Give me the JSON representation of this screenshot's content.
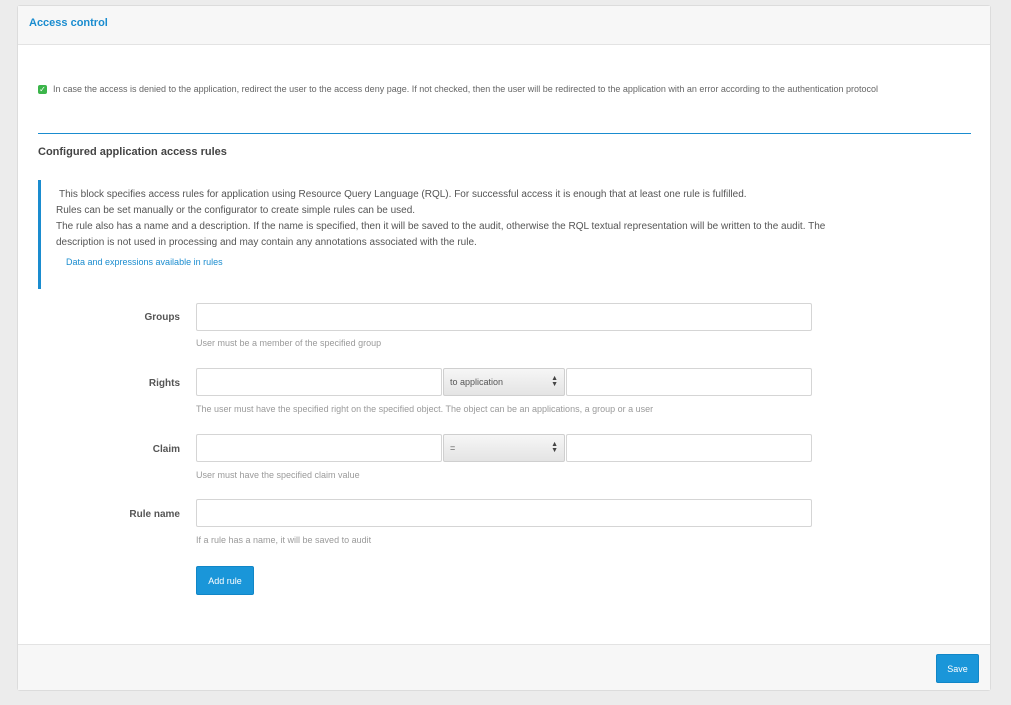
{
  "panel": {
    "title": "Access control"
  },
  "redirect_option": {
    "checked": true,
    "label": "In case the access is denied to the application, redirect the user to the access deny page. If not checked, then the user will be redirected to the application with an error according to the authentication protocol"
  },
  "rules_section": {
    "title": "Configured application access rules",
    "info_lines": [
      "This block specifies access rules for application using Resource Query Language (RQL). For successful access it is enough that at least one rule is fulfilled.",
      "Rules can be set manually or the configurator to create simple rules can be used.",
      "The rule also has a name and a description. If the name is specified, then it will be saved to the audit, otherwise the RQL textual representation will be written to the audit. The",
      "description is not used in processing and may contain any annotations associated with the rule."
    ],
    "info_link": "Data and expressions available in rules"
  },
  "form": {
    "groups": {
      "label": "Groups",
      "value": "",
      "help": "User must be a member of the specified group"
    },
    "rights": {
      "label": "Rights",
      "value": "",
      "selected": "to application",
      "object": "",
      "help": "The user must have the specified right on the specified object. The object can be an applications, a group or a user"
    },
    "claim": {
      "label": "Claim",
      "value": "",
      "operator": "=",
      "claim_value": "",
      "help": "User must have the specified claim value"
    },
    "rule_name": {
      "label": "Rule name",
      "value": "",
      "help": "If a rule has a name, it will be saved to audit"
    },
    "add_rule_label": "Add rule"
  },
  "footer": {
    "save_label": "Save"
  },
  "colors": {
    "accent": "#1a8ccf",
    "checkbox": "#3bb54a",
    "button": "#1a96d9"
  }
}
